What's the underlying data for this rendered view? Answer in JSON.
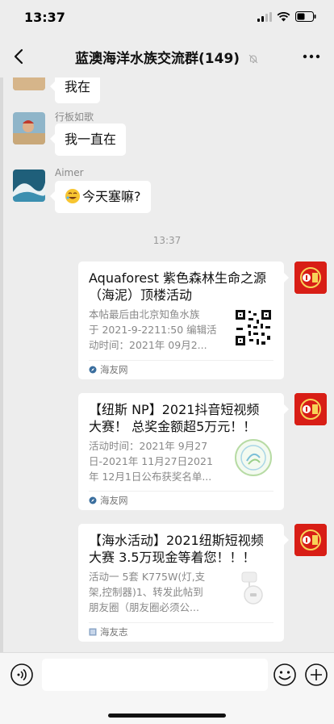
{
  "status": {
    "time": "13:37"
  },
  "header": {
    "title": "蓝澳海洋水族交流群(149)"
  },
  "messages": [
    {
      "sender": "",
      "text": "我在"
    },
    {
      "sender": "行板如歌",
      "text": "我一直在"
    },
    {
      "sender": "Aimer",
      "text": "今天塞嘛?"
    }
  ],
  "timestamp": "13:37",
  "cards": [
    {
      "title_line1": "Aquaforest 紫色森林生命之源",
      "title_line2": "（海泥）顶楼活动",
      "desc_line1": "本帖最后由北京知鱼水族",
      "desc_line2": "于 2021-9-2211:50 编辑活",
      "desc_line3": "动时间：2021年 09月2...",
      "source": "海友网",
      "thumb_icon": "qr-code-icon"
    },
    {
      "title_line1": "【纽斯 NP】2021抖音短视频",
      "title_line2": "大赛！ 总奖金额超5万元！！",
      "desc_line1": "活动时间：2021年 9月27",
      "desc_line2": "日-2021年 11月27日2021",
      "desc_line3": "年 12月1日公布获奖名单...",
      "source": "海友网",
      "thumb_icon": "contest-logo-icon"
    },
    {
      "title_line1": "【海水活动】2021纽斯短视频",
      "title_line2": "大赛 3.5万现金等着您！！！",
      "desc_line1": "活动一 5套 K775W(灯,支",
      "desc_line2": "架,控制器)1、转发此帖到",
      "desc_line3": "朋友圈（朋友圈必须公...",
      "source": "海友志",
      "thumb_icon": "product-thumb-icon"
    }
  ],
  "icons": {
    "back": "chevron-left-icon",
    "mute": "mute-bell-icon",
    "more": "more-dots-icon",
    "voice": "voice-icon",
    "emoji": "emoji-icon",
    "plus": "plus-icon",
    "sender_avatar": "logo-avatar"
  },
  "colors": {
    "background": "#ededed",
    "bubble": "#ffffff",
    "brand_avatar": "#d81e16",
    "meta_text": "#888888"
  }
}
